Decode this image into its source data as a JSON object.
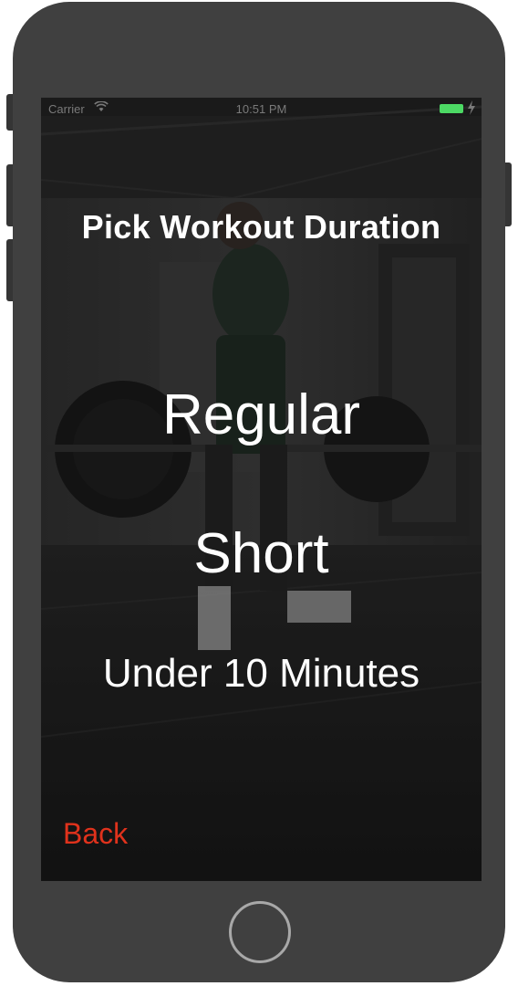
{
  "status_bar": {
    "carrier": "Carrier",
    "time": "10:51 PM",
    "battery_color": "#4cd964"
  },
  "screen": {
    "title": "Pick Workout Duration",
    "options": [
      {
        "label": "Regular"
      },
      {
        "label": "Short"
      },
      {
        "label": "Under 10 Minutes"
      }
    ],
    "back_label": "Back",
    "back_color": "#e0321c"
  },
  "device": {
    "frame_color": "#404040"
  }
}
